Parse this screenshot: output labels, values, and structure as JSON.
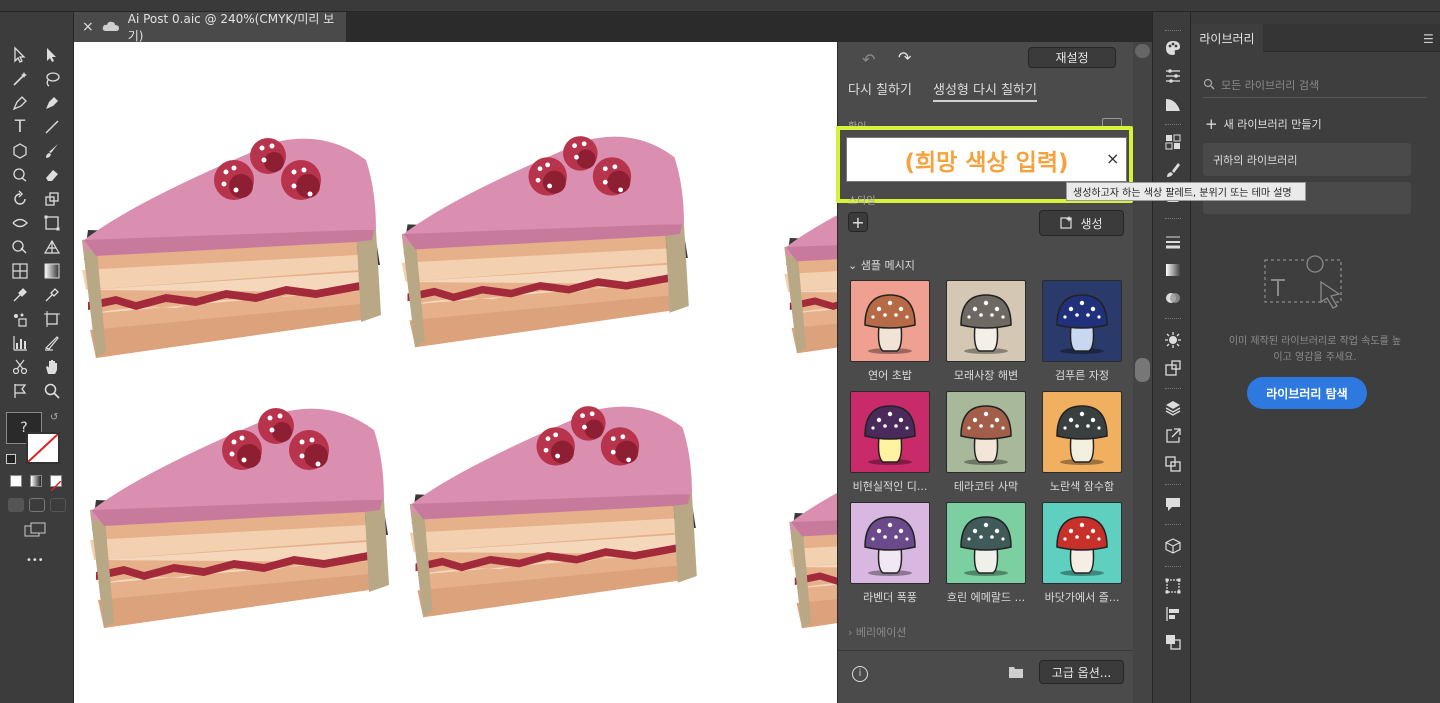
{
  "document_tab": {
    "title": "Ai Post 0.aic @ 240%(CMYK/미리 보기)",
    "close": "×"
  },
  "toolbar": {
    "unknown_fill": "?",
    "more": "•••"
  },
  "recolor": {
    "reset_label": "재설정",
    "tabs": [
      {
        "label": "다시 칠하기"
      },
      {
        "label": "생성형 다시 칠하기"
      }
    ],
    "prompt_section_label": "확인",
    "prompt_value": "(희망 색상 입력)",
    "prompt_clear": "×",
    "tooltip": "생성하고자 하는 색상 팔레트, 분위기 또는 테마 설명",
    "style_label": "스타일",
    "add_label": "+",
    "generate_label": "생성",
    "samples_label": "샘플 메시지",
    "samples": [
      {
        "label": "연어 초밥",
        "bg": "#f0a090",
        "cap": "#b66a45",
        "stem": "#f1e4d6"
      },
      {
        "label": "모래사장 해변",
        "bg": "#d4c7b4",
        "cap": "#6e6a63",
        "stem": "#f4efe7"
      },
      {
        "label": "검푸른 자정",
        "bg": "#2a3a6a",
        "cap": "#20307a",
        "stem": "#c8d8f0"
      },
      {
        "label": "비현실적인 디...",
        "bg": "#c82a6a",
        "cap": "#4a2a5a",
        "stem": "#fff2a0"
      },
      {
        "label": "테라코타 사막",
        "bg": "#a8b89a",
        "cap": "#a25e48",
        "stem": "#f3e6d8"
      },
      {
        "label": "노란색 잠수함",
        "bg": "#f0b060",
        "cap": "#3a4040",
        "stem": "#f4f0e0"
      },
      {
        "label": "라벤더 폭풍",
        "bg": "#d8b8e0",
        "cap": "#6a4a8a",
        "stem": "#f1e8f4"
      },
      {
        "label": "흐린 에메랄드 ...",
        "bg": "#7ccfa0",
        "cap": "#3f5a58",
        "stem": "#f0f0ea"
      },
      {
        "label": "바닷가에서 즐...",
        "bg": "#5fcfc0",
        "cap": "#c8302a",
        "stem": "#f6eee4"
      }
    ],
    "variations_label": "베리에이션",
    "advanced_label": "고급 옵션..."
  },
  "library": {
    "title": "라이브러리",
    "search_placeholder": "모든 라이브러리 검색",
    "new_library": "새 라이브러리 만들기",
    "your_library": "귀하의 라이브러리",
    "empty_text_1": "이미 제작된 라이브러리로 작업 속도를 높",
    "empty_text_2": "이고 영감을 주세요.",
    "browse_label": "라이브러리 탐색"
  },
  "colors": {
    "accent": "#2d79e0",
    "highlight": "#d8f23a",
    "prompt_text": "#f5a23c"
  }
}
